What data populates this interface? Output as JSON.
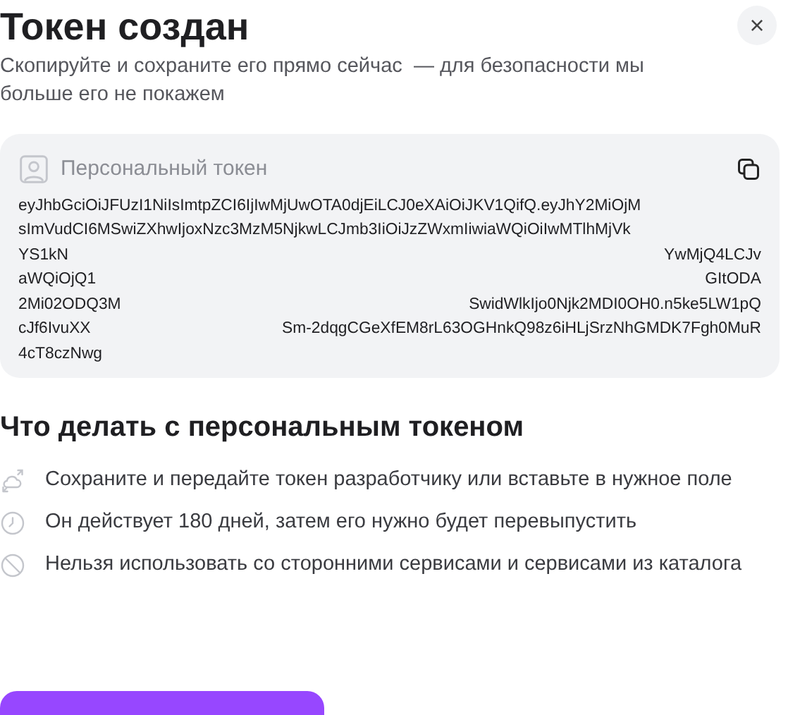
{
  "dialog": {
    "title": "Токен создан",
    "close": "×",
    "subtitle": "Скопируйте и сохраните его прямо сейчас  — для безопасности мы больше его не покажем"
  },
  "token_card": {
    "label": "Персональный токен",
    "lines": [
      {
        "left": "eyJhbGciOiJFUzI1NiIsImtpZCI6IjIwMjUwOTA0djEiLCJ0eXAiOiJKV1QifQ.eyJhY2MiOjM"
      },
      {
        "left": "sImVudCI6MSwiZXhwIjoxNzc3MzM5NjkwLCJmb3IiOiJzZWxmIiwiaWQiOiIwMTlhMjVk"
      },
      {
        "left": "YS1kN",
        "right": "YwMjQ4LCJv"
      },
      {
        "left": "aWQiOjQ1",
        "right": "GItODA"
      },
      {
        "left": "2Mi02ODQ3M",
        "right": "SwidWlkIjo0Njk2MDI0OH0.n5ke5LW1pQ"
      },
      {
        "left": "cJf6IvuXX",
        "right": "Sm-2dqgCGeXfEM8rL63OGHnkQ98z6iHLjSrzNhGMDK7Fgh0MuR"
      },
      {
        "left": "4cT8czNwg"
      }
    ]
  },
  "instructions": {
    "heading": "Что делать с персональным токеном",
    "items": [
      {
        "kind": "share",
        "text": "Сохраните и передайте токен разработчику или вставьте в нужное поле"
      },
      {
        "kind": "clock",
        "text": "Он действует 180 дней, затем его нужно будет перевыпустить"
      },
      {
        "kind": "forbidden",
        "text": "Нельзя использовать со сторонними сервисами и сервисами из каталога"
      }
    ]
  }
}
